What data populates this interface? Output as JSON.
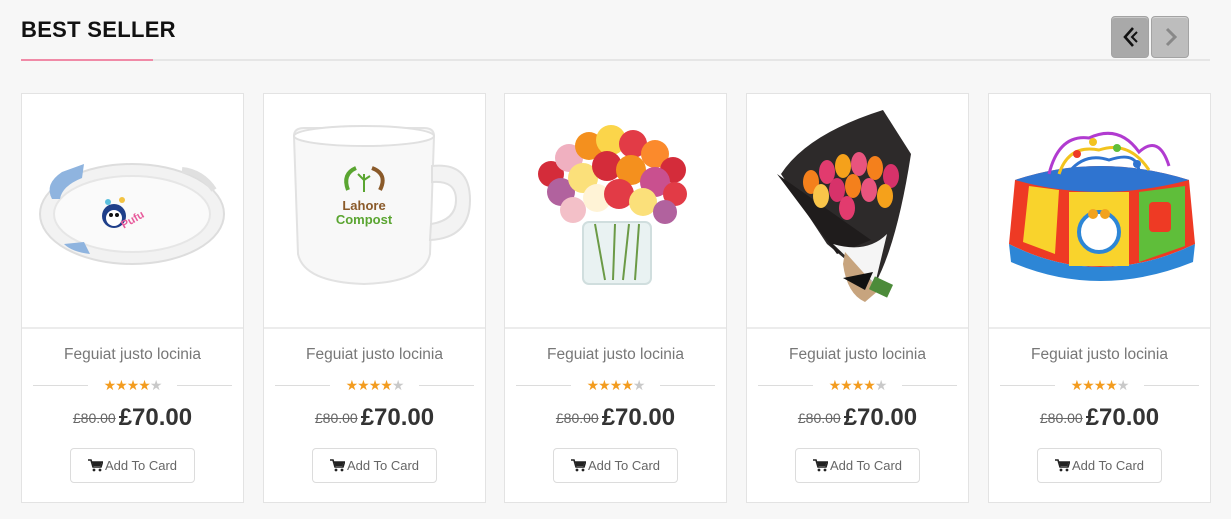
{
  "section": {
    "title": "BEST SELLER",
    "accent_color": "#f08aa7"
  },
  "nav": {
    "prev_icon": "chevron-left-icon",
    "next_icon": "chevron-right-icon"
  },
  "products": [
    {
      "name": "Feguiat justo locinia",
      "rating": 4,
      "max_rating": 5,
      "old_price": "£80.00",
      "new_price": "£70.00",
      "button_label": "Add To Card",
      "image": "baby-bathtub"
    },
    {
      "name": "Feguiat justo locinia",
      "rating": 4,
      "max_rating": 5,
      "old_price": "£80.00",
      "new_price": "£70.00",
      "button_label": "Add To Card",
      "image": "white-mug",
      "image_text": [
        "Lahore",
        "Compost"
      ]
    },
    {
      "name": "Feguiat justo locinia",
      "rating": 4,
      "max_rating": 5,
      "old_price": "£80.00",
      "new_price": "£70.00",
      "button_label": "Add To Card",
      "image": "rose-vase"
    },
    {
      "name": "Feguiat justo locinia",
      "rating": 4,
      "max_rating": 5,
      "old_price": "£80.00",
      "new_price": "£70.00",
      "button_label": "Add To Card",
      "image": "tulip-bouquet"
    },
    {
      "name": "Feguiat justo locinia",
      "rating": 4,
      "max_rating": 5,
      "old_price": "£80.00",
      "new_price": "£70.00",
      "button_label": "Add To Card",
      "image": "activity-toy"
    }
  ],
  "colors": {
    "star": "#f39c1f",
    "star_empty": "#c9c9c9"
  }
}
